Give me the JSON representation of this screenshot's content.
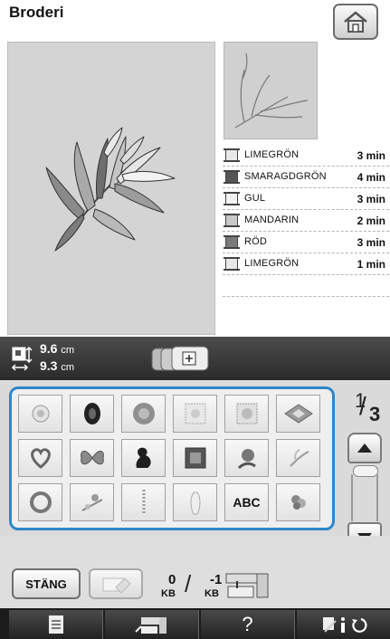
{
  "header": {
    "title": "Broderi"
  },
  "icons": {
    "home": "home-icon",
    "pattern_thumbnail": "embroidery-thumbnail",
    "size": "size-arrows-icon",
    "frame": "embroidery-frame-icon",
    "erase": "eraser-icon",
    "send": "machine-memory-icon",
    "nav_document": "document-icon",
    "nav_machine": "embroidery-machine-icon",
    "nav_help": "help-icon",
    "nav_settings": "settings-info-icon"
  },
  "threads": [
    {
      "name": "LIMEGRÖN",
      "time": "3 min",
      "color": "#e8e8e8"
    },
    {
      "name": "SMARAGDGRÖN",
      "time": "4 min",
      "color": "#555555"
    },
    {
      "name": "GUL",
      "time": "3 min",
      "color": "#f2f2f2"
    },
    {
      "name": "MANDARIN",
      "time": "2 min",
      "color": "#c8c8c8"
    },
    {
      "name": "RÖD",
      "time": "3 min",
      "color": "#7a7a7a"
    },
    {
      "name": "LIMEGRÖN",
      "time": "1 min",
      "color": "#e8e8e8"
    }
  ],
  "size": {
    "width_value": "9.6",
    "height_value": "9.3",
    "unit": "cm"
  },
  "pattern_grid": {
    "rows": [
      [
        "flower-medallion",
        "dark-oval",
        "round-medallion",
        "floral-square",
        "floral-square-2",
        "diamond-ornament"
      ],
      [
        "heart-wreath",
        "butterfly",
        "swan-silhouette",
        "lace-square",
        "rose",
        "leaf-spray"
      ],
      [
        "round-wreath",
        "bird-branch",
        "vertical-border",
        "vase",
        "ABC",
        "flower-cluster"
      ]
    ],
    "text_cell": "ABC"
  },
  "pagination": {
    "current": "1",
    "total": "3"
  },
  "buttons": {
    "close": "STÄNG"
  },
  "memory": {
    "used_value": "0",
    "used_unit": "KB",
    "free_value": "-1",
    "free_unit": "KB",
    "separator": "/"
  },
  "nav": {
    "help": "?"
  },
  "colors": {
    "accent": "#2f86c8",
    "info_bar": "#3a3a3a",
    "nav_bar": "#1c1c1c"
  }
}
